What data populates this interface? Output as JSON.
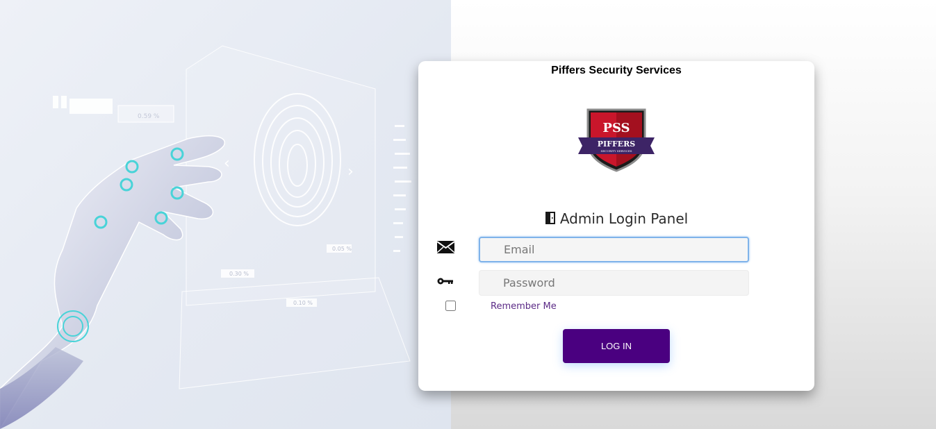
{
  "header": {
    "company_name": "Piffers Security Services"
  },
  "logo": {
    "abbreviation": "PSS",
    "name": "PIFFERS",
    "tagline": "SECURITY SERVICES"
  },
  "login": {
    "panel_title": "Admin Login Panel",
    "email_placeholder": "Email",
    "password_placeholder": "Password",
    "remember_label": "Remember Me",
    "login_button": "LOG IN"
  },
  "hero": {
    "readouts": [
      "0.59 %",
      "0.05 %",
      "0.30 %",
      "0.10 %"
    ]
  },
  "icons": {
    "title_icon": "door-icon",
    "email_icon": "envelope-icon",
    "password_icon": "key-icon"
  },
  "colors": {
    "accent": "#4a0080",
    "remember_text": "#5b2a86",
    "focus_border": "#7fb3ea"
  }
}
